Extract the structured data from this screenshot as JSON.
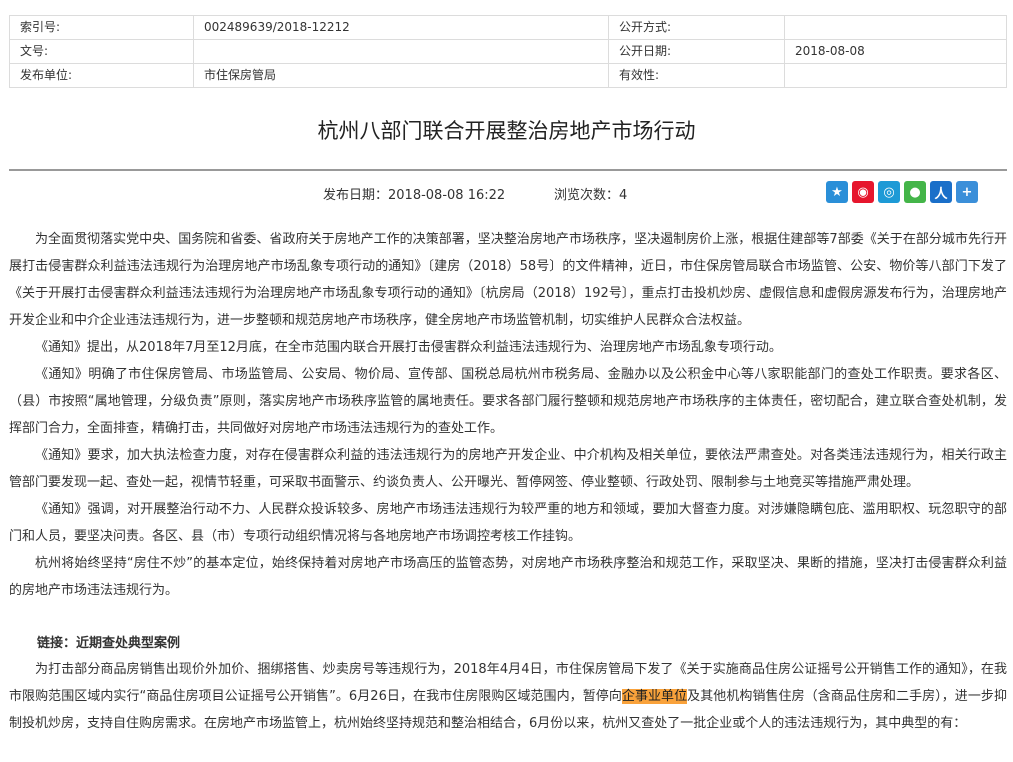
{
  "meta": {
    "index_label": "索引号:",
    "index_value": "002489639/2018-12212",
    "public_way_label": "公开方式:",
    "public_way_value": "",
    "doc_no_label": "文号:",
    "doc_no_value": "",
    "public_date_label": "公开日期:",
    "public_date_value": "2018-08-08",
    "publisher_label": "发布单位:",
    "publisher_value": "市住保房管局",
    "validity_label": "有效性:",
    "validity_value": ""
  },
  "article": {
    "title": "杭州八部门联合开展整治房地产市场行动",
    "publish_label": "发布日期：",
    "publish_value": "2018-08-08 16:22",
    "views_label": "浏览次数：",
    "views_value": "4"
  },
  "share": {
    "icons": [
      "qzone-icon",
      "weibo-icon",
      "tencent-weibo-icon",
      "wechat-icon",
      "renren-icon",
      "more-share-icon"
    ],
    "colors": {
      "qzone": "#2a8fd8",
      "weibo": "#e6162d",
      "tweibo": "#1d9ad6",
      "wechat": "#44b549",
      "renren": "#1a6fc9",
      "more": "#3b8fd9"
    }
  },
  "paragraphs": [
    "为全面贯彻落实党中央、国务院和省委、省政府关于房地产工作的决策部署，坚决整治房地产市场秩序，坚决遏制房价上涨，根据住建部等7部委《关于在部分城市先行开展打击侵害群众利益违法违规行为治理房地产市场乱象专项行动的通知》〔建房（2018）58号〕的文件精神，近日，市住保房管局联合市场监管、公安、物价等八部门下发了《关于开展打击侵害群众利益违法违规行为治理房地产市场乱象专项行动的通知》〔杭房局（2018）192号〕，重点打击投机炒房、虚假信息和虚假房源发布行为，治理房地产开发企业和中介企业违法违规行为，进一步整顿和规范房地产市场秩序，健全房地产市场监管机制，切实维护人民群众合法权益。",
    "《通知》提出，从2018年7月至12月底，在全市范围内联合开展打击侵害群众利益违法违规行为、治理房地产市场乱象专项行动。",
    "《通知》明确了市住保房管局、市场监管局、公安局、物价局、宣传部、国税总局杭州市税务局、金融办以及公积金中心等八家职能部门的查处工作职责。要求各区、（县）市按照“属地管理，分级负责”原则，落实房地产市场秩序监管的属地责任。要求各部门履行整顿和规范房地产市场秩序的主体责任，密切配合，建立联合查处机制，发挥部门合力，全面排查，精确打击，共同做好对房地产市场违法违规行为的查处工作。",
    "《通知》要求，加大执法检查力度，对存在侵害群众利益的违法违规行为的房地产开发企业、中介机构及相关单位，要依法严肃查处。对各类违法违规行为，相关行政主管部门要发现一起、查处一起，视情节轻重，可采取书面警示、约谈负责人、公开曝光、暂停网签、停业整顿、行政处罚、限制参与土地竞买等措施严肃处理。",
    "《通知》强调，对开展整治行动不力、人民群众投诉较多、房地产市场违法违规行为较严重的地方和领域，要加大督查力度。对涉嫌隐瞒包庇、滥用职权、玩忽职守的部门和人员，要坚决问责。各区、县（市）专项行动组织情况将与各地房地产市场调控考核工作挂钩。",
    "杭州将始终坚持“房住不炒”的基本定位，始终保持着对房地产市场高压的监管态势，对房地产市场秩序整治和规范工作，采取坚决、果断的措施，坚决打击侵害群众利益的房地产市场违法违规行为。"
  ],
  "link_heading": "链接：近期查处典型案例",
  "last_paragraph": {
    "before": "为打击部分商品房销售出现价外加价、捆绑搭售、炒卖房号等违规行为，2018年4月4日，市住保房管局下发了《关于实施商品住房公证摇号公开销售工作的通知》，在我市限购范围区域内实行“商品住房项目公证摇号公开销售”。6月26日，在我市住房限购区域范围内，暂停向",
    "highlight": "企事业单位",
    "after": "及其他机构销售住房（含商品住房和二手房），进一步抑制投机炒房，支持自住购房需求。在房地产市场监管上，杭州始终坚持规范和整治相结合，6月份以来，杭州又查处了一批企业或个人的违法违规行为，其中典型的有："
  }
}
